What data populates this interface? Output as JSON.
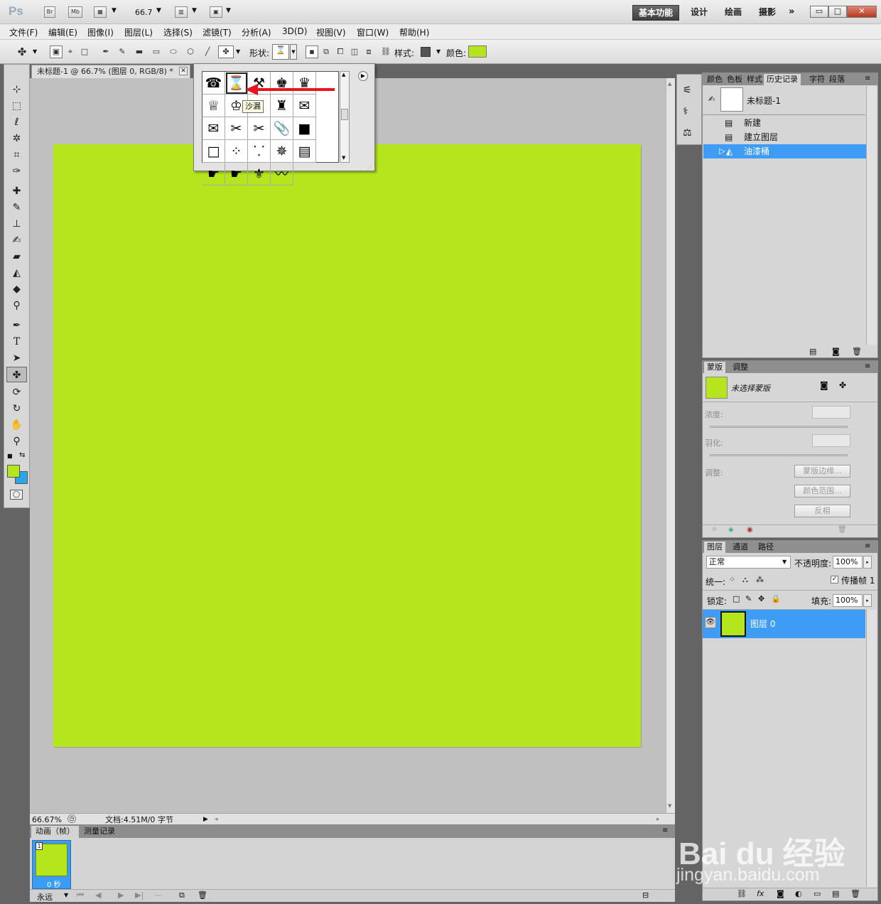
{
  "app": {
    "logo": "Ps",
    "bridge_btn": "Br",
    "minibridge_btn": "Mb",
    "zoom_value": "66.7"
  },
  "workspaces": [
    "基本功能",
    "设计",
    "绘画",
    "摄影"
  ],
  "window_controls": {
    "minimize": "▭",
    "restore": "□",
    "close": "✕"
  },
  "menu": [
    "文件(F)",
    "编辑(E)",
    "图像(I)",
    "图层(L)",
    "选择(S)",
    "滤镜(T)",
    "分析(A)",
    "3D(D)",
    "视图(V)",
    "窗口(W)",
    "帮助(H)"
  ],
  "options": {
    "shape_label": "形状:",
    "style_label": "样式:",
    "color_label": "颜色:",
    "color": "#b5e61d"
  },
  "document": {
    "tab_title": "未标题-1 @ 66.7% (图层 0, RGB/8) *",
    "canvas_color": "#b5e61d"
  },
  "status": {
    "zoom": "66.67%",
    "doc_info": "文档:4.51M/0 字节"
  },
  "animation": {
    "tabs": [
      "动画（帧）",
      "测量记录"
    ],
    "frame_number": "1",
    "frame_delay": "0 秒",
    "loop": "永远"
  },
  "shape_picker": {
    "shapes": [
      "☎",
      "⌛",
      "⚒",
      "♚",
      "♛",
      "♕",
      "♔",
      "♛",
      "♜",
      "✉",
      "✉",
      "✂",
      "✂",
      "📎",
      "■",
      "□",
      "⁘",
      "⸪",
      "✵",
      "▤",
      "☛",
      "☛",
      "⚜",
      "〰"
    ],
    "selected_index": 1,
    "tooltip": "沙漏"
  },
  "history_panel": {
    "tabs": [
      "颜色",
      "色板",
      "样式",
      "历史记录",
      "字符",
      "段落"
    ],
    "snapshot": "未标题-1",
    "items": [
      "新建",
      "建立图层",
      "油漆桶"
    ],
    "selected_item": "油漆桶"
  },
  "masks_panel": {
    "tabs": [
      "蒙版",
      "调整"
    ],
    "mask_label": "未选择蒙版",
    "density_label": "浓度:",
    "feather_label": "羽化:",
    "adjust_label": "调整:",
    "buttons": [
      "蒙版边缘...",
      "颜色范围...",
      "反相"
    ]
  },
  "layers_panel": {
    "tabs": [
      "图层",
      "通道",
      "路径"
    ],
    "blend_mode": "正常",
    "opacity_label": "不透明度:",
    "opacity": "100%",
    "unify_label": "统一:",
    "propagate_label": "传播帧 1",
    "lock_label": "锁定:",
    "fill_label": "填充:",
    "fill": "100%",
    "layer_name": "图层 0"
  },
  "watermark": {
    "logo": "Bai du 经验",
    "url": "jingyan.baidu.com"
  }
}
